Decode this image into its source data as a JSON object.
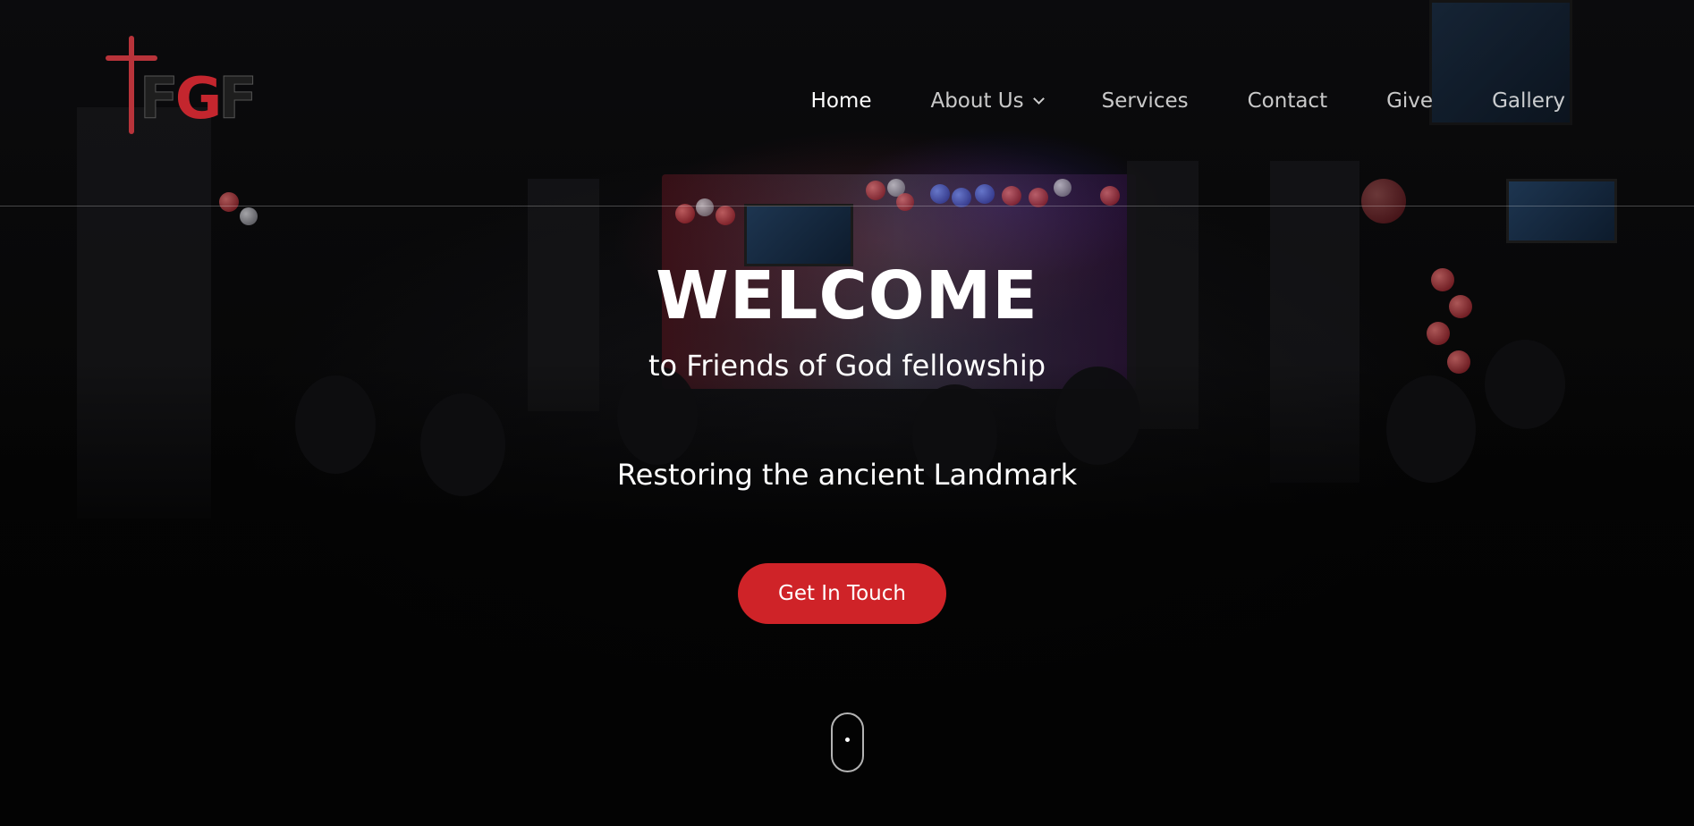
{
  "logo": {
    "text_left": "F",
    "text_mid": "G",
    "text_right": "F"
  },
  "nav": {
    "items": [
      {
        "label": "Home",
        "active": true
      },
      {
        "label": "About Us",
        "has_dropdown": true
      },
      {
        "label": "Services"
      },
      {
        "label": "Contact"
      },
      {
        "label": "Give"
      },
      {
        "label": "Gallery"
      }
    ]
  },
  "hero": {
    "heading": "WELCOME",
    "subtitle": "to Friends of God fellowship",
    "tagline": "Restoring the ancient Landmark",
    "cta_label": "Get In Touch"
  },
  "colors": {
    "accent": "#cf2328",
    "background": "#050505",
    "text": "#ffffff"
  },
  "icons": {
    "dropdown": "chevron-down-icon",
    "scroll": "mouse-scroll-icon"
  }
}
